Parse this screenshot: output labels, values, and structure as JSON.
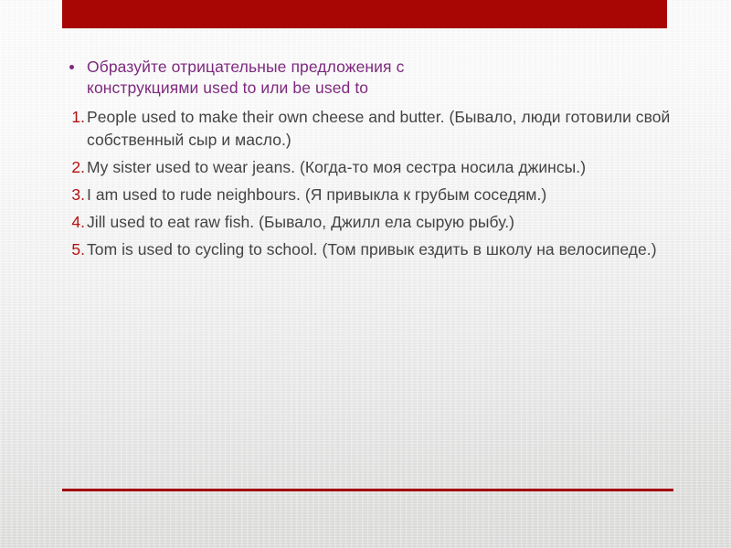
{
  "slide": {
    "title_bar": {
      "text": "",
      "color": "#a80505"
    },
    "accent_colors": {
      "bar_red": "#a80505",
      "rule_red": "#a30808",
      "number_red": "#b31111",
      "bullet_purple": "#7d2a7d",
      "body_gray": "#434343"
    },
    "bullet": {
      "marker": "•",
      "text": "Образуйте отрицательные предложения с конструкциями used to или be used to"
    },
    "exercises": [
      {
        "number": "1.",
        "text": "People used to make their own cheese and butter. (Бывало, люди готовили свой собственный сыр и масло.)",
        "justified": false
      },
      {
        "number": "2.",
        "text": "My sister used to wear jeans. (Когда-то моя сестра носила джинсы.)",
        "justified": false
      },
      {
        "number": "3.",
        "text": "I am used to rude neighbours. (Я привыкла к грубым соседям.)",
        "justified": true
      },
      {
        "number": "4.",
        "text": "Jill used to eat raw fish. (Бывало, Джилл ела сырую рыбу.)",
        "justified": false
      },
      {
        "number": "5.",
        "text": "Tom is used to cycling to school. (Том привык ездить в школу на велосипеде.)",
        "justified": true
      }
    ]
  }
}
